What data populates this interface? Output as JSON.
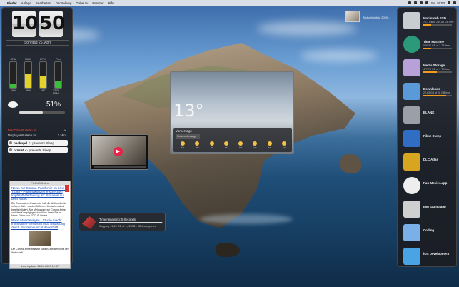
{
  "menubar": {
    "apple": "",
    "app": "Finder",
    "items": [
      "Ablage",
      "Bearbeiten",
      "Darstellung",
      "Gehe zu",
      "Fenster",
      "Hilfe"
    ],
    "clock": "So. 16:50"
  },
  "clock": {
    "hour": "10",
    "minute": "50",
    "date": "Sonntag 26. April"
  },
  "meters": [
    {
      "label": "CPU",
      "value": "18%",
      "level": 0.18,
      "color": "#3bbf3b"
    },
    {
      "label": "RAM",
      "value": "55%",
      "level": 0.55,
      "color": "#e3d22b"
    },
    {
      "label": "CPU°",
      "value": "46°",
      "level": 0.46,
      "color": "#e3d22b"
    },
    {
      "label": "Fan",
      "value": "1300 RPM",
      "level": 0.25,
      "color": "#3bbf3b"
    }
  ],
  "battery": {
    "percent": "51%",
    "level": 0.51
  },
  "sleep": {
    "line1": "MacOS will sleep in:",
    "line1_value": "∞",
    "line2": "Display will sleep in:",
    "line2_value": "1 Min."
  },
  "prevent": [
    {
      "name": "backupd",
      "text": " <- prevents Sleep"
    },
    {
      "name": "prnset",
      "text": " <- prevents Sleep"
    }
  ],
  "news": {
    "header": "FOCUS Online",
    "link1": "News zur Corona-Pandemie im Live-Ticker - Pharmakonzerne sprechen Impfstoff-Verteilung ab: Situation auf dem Markt",
    "text1": "Die Coronavirus-Pandemie hält die Welt weiterhin in Atem. Mehr als drei Millionen Menschen sind bereits infiziert. Alle Meldungen zur Corona-Krise und den Kampf gegen das Virus lesen Sie im News-Ticker von FOCUS Online.",
    "link2": "Neue Marktanalyse - Studie macht Immobilien-Besitzern Mut: Belastung durch Pandemie nicht dauerhaft",
    "text2": "Die Corona-Krise belastet nahezu alle Bereiche der Wirtschaft.",
    "footer": "Last Update: 26.04.2020 10:47"
  },
  "copy_progress": {
    "title": "Time remaining: 5 Seconds",
    "detail": "Copying - 1,20 GB of 1,22 GB - 98% completed",
    "fraction": 0.98
  },
  "weather": {
    "temp": "13°",
    "title": "Vorhersage",
    "selector": "Reisevorhersage",
    "days": [
      "SO",
      "MO",
      "DI",
      "MI",
      "DO",
      "FR",
      "SA",
      "SO"
    ]
  },
  "desktop_photo": {
    "label": "Bildschirmfoto 2020..."
  },
  "dock_items": [
    {
      "name": "Macintosh SSD",
      "sub": "70,7 GB of 249,66 GB free",
      "bar": 0.28,
      "color": "#c9ccd0"
    },
    {
      "name": "Time Machine",
      "sub": "546,32 GB of 2 TB free",
      "bar": 0.27,
      "color": "#2a9a7a"
    },
    {
      "name": "Media Storage",
      "sub": "477,73 GB of 1 TB free",
      "bar": 0.48,
      "color": "#b8a0d8"
    },
    {
      "name": "Downloads",
      "sub": "22,63 GB of 28 GB free",
      "bar": 0.81,
      "color": "#5a9ad8"
    },
    {
      "name": "BLANK",
      "sub": "",
      "bar": null,
      "color": "#9aa0a8"
    },
    {
      "name": "Filme Dump",
      "sub": "",
      "bar": null,
      "color": "#2f6ec2"
    },
    {
      "name": "DLC Atlas",
      "sub": "",
      "bar": null,
      "color": "#d8a520"
    },
    {
      "name": "Fun-Movies.app",
      "sub": "",
      "bar": null,
      "color": "#eeeeee"
    },
    {
      "name": "Img_Dump.app",
      "sub": "",
      "bar": null,
      "color": "#cfcfcf"
    },
    {
      "name": "Coding",
      "sub": "",
      "bar": null,
      "color": "#7ab0e8"
    },
    {
      "name": "iOS Development",
      "sub": "",
      "bar": null,
      "color": "#4aa3e2"
    }
  ]
}
